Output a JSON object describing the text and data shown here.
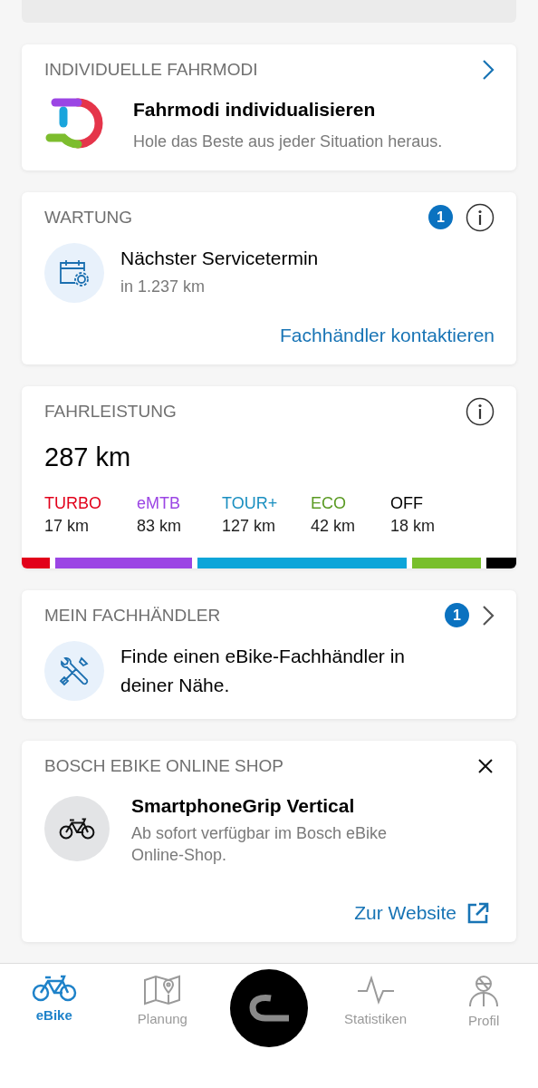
{
  "fahrmodi": {
    "title": "INDIVIDUELLE FAHRMODI",
    "heading": "Fahrmodi individualisieren",
    "subtitle": "Hole das Beste aus jeder Situation heraus."
  },
  "wartung": {
    "title": "WARTUNG",
    "badge": "1",
    "heading": "Nächster Servicetermin",
    "subtitle": "in 1.237 km",
    "link": "Fachhändler kontaktieren"
  },
  "fahrleistung": {
    "title": "FAHRLEISTUNG",
    "total": "287 km",
    "modes": [
      {
        "name": "TURBO",
        "distance": "17 km",
        "color": "#e2001a"
      },
      {
        "name": "eMTB",
        "distance": "83 km",
        "color": "#9b45e4"
      },
      {
        "name": "TOUR+",
        "distance": "127 km",
        "color": "#1a8fc0"
      },
      {
        "name": "ECO",
        "distance": "42 km",
        "color": "#5a9a22"
      },
      {
        "name": "OFF",
        "distance": "18 km",
        "color": "#000000"
      }
    ]
  },
  "haendler": {
    "title": "MEIN FACHHÄNDLER",
    "badge": "1",
    "text": "Finde einen eBike-Fachhändler in deiner Nähe."
  },
  "shop": {
    "title": "BOSCH EBIKE ONLINE SHOP",
    "heading": "SmartphoneGrip Vertical",
    "subtitle": "Ab sofort verfügbar im Bosch eBike Online-Shop.",
    "link": "Zur Website"
  },
  "nav": [
    {
      "kind": "bike",
      "label": "eBike",
      "selected": true
    },
    {
      "kind": "map",
      "label": "Planung",
      "selected": false
    },
    {
      "kind": "center",
      "selected": false
    },
    {
      "kind": "stats",
      "label": "Statistiken",
      "selected": false
    },
    {
      "kind": "profile",
      "label": "Profil",
      "selected": false
    }
  ]
}
